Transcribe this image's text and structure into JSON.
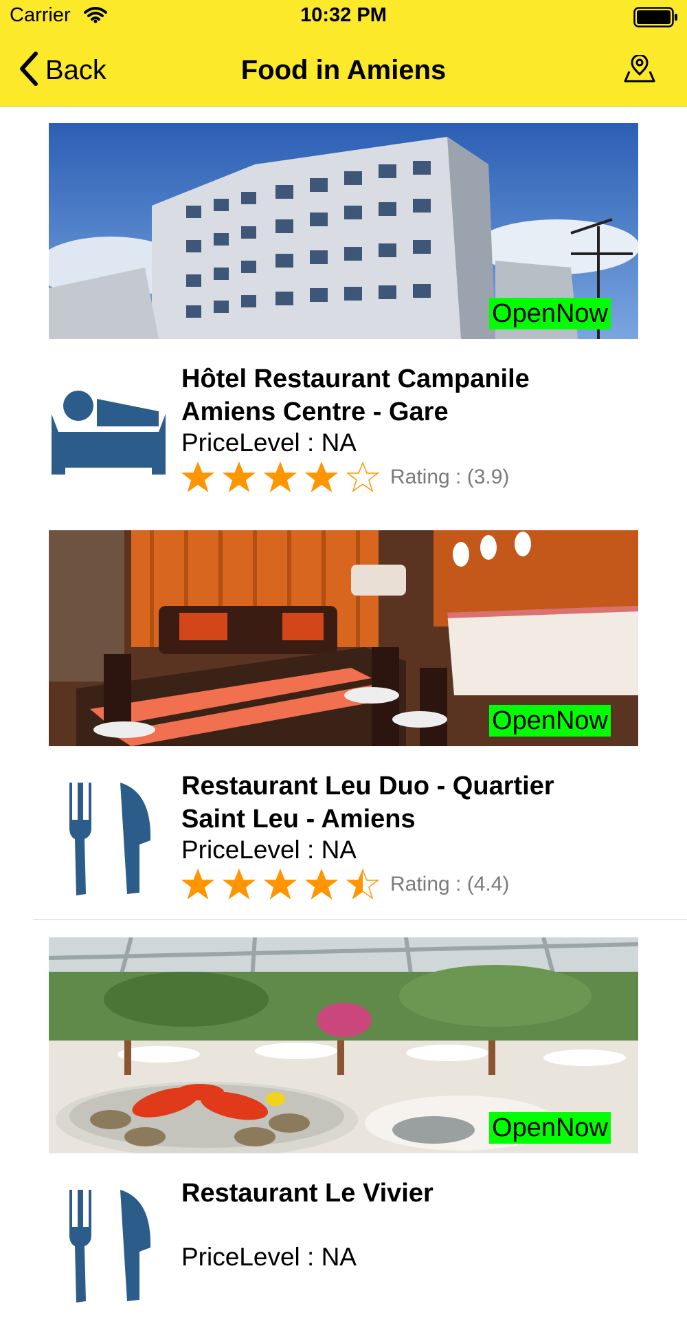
{
  "status_bar": {
    "carrier": "Carrier",
    "time": "10:32 PM"
  },
  "nav": {
    "back_label": "Back",
    "title": "Food in Amiens"
  },
  "colors": {
    "bar": "#fbe92a",
    "accent_star": "#ff9500",
    "open_badge": "#00ff00",
    "icon_blue": "#2c5c8a"
  },
  "places": [
    {
      "name": "Hôtel Restaurant Campanile Amiens Centre - Gare",
      "price": "PriceLevel : NA",
      "rating_label": "Rating : (3.9)",
      "rating": 3.9,
      "status": "OpenNow",
      "type_icon": "bed-icon"
    },
    {
      "name": "Restaurant Leu Duo - Quartier Saint Leu - Amiens",
      "price": "PriceLevel : NA",
      "rating_label": "Rating : (4.4)",
      "rating": 4.4,
      "status": "OpenNow",
      "type_icon": "fork-knife-icon"
    },
    {
      "name": "Restaurant Le Vivier",
      "price": "PriceLevel : NA",
      "rating_label": "",
      "rating": null,
      "status": "OpenNow",
      "type_icon": "fork-knife-icon"
    }
  ]
}
